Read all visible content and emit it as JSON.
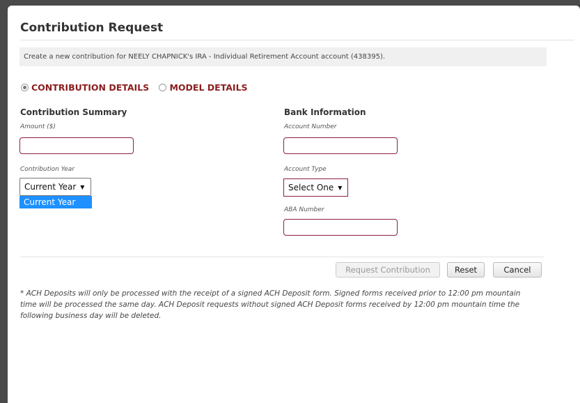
{
  "dialog": {
    "title": "Contribution Request",
    "info": "Create a new contribution for NEELY CHAPNICK's IRA - Individual Retirement Account account (438395)."
  },
  "tabs": [
    {
      "label": "CONTRIBUTION DETAILS",
      "selected": true
    },
    {
      "label": "MODEL DETAILS",
      "selected": false
    }
  ],
  "summary": {
    "heading": "Contribution Summary",
    "amount_label": "Amount ($)",
    "amount_value": "",
    "year_label": "Contribution Year",
    "year_value": "Current Year",
    "year_options": [
      "Current Year"
    ]
  },
  "bank": {
    "heading": "Bank Information",
    "account_number_label": "Account Number",
    "account_number_value": "",
    "account_type_label": "Account Type",
    "account_type_value": "Select One",
    "aba_label": "ABA Number",
    "aba_value": ""
  },
  "buttons": {
    "request": "Request Contribution",
    "reset": "Reset",
    "cancel": "Cancel"
  },
  "note": "* ACH Deposits will only be processed with the receipt of a signed ACH Deposit form. Signed forms received prior to 12:00 pm mountain time will be processed the same day. ACH Deposit requests without signed ACH Deposit forms received by 12:00 pm mountain time the following business day will be deleted.",
  "colors": {
    "accent": "#8b1e1e",
    "field_border": "#8b1e3f",
    "dropdown_highlight": "#1e90ff"
  }
}
